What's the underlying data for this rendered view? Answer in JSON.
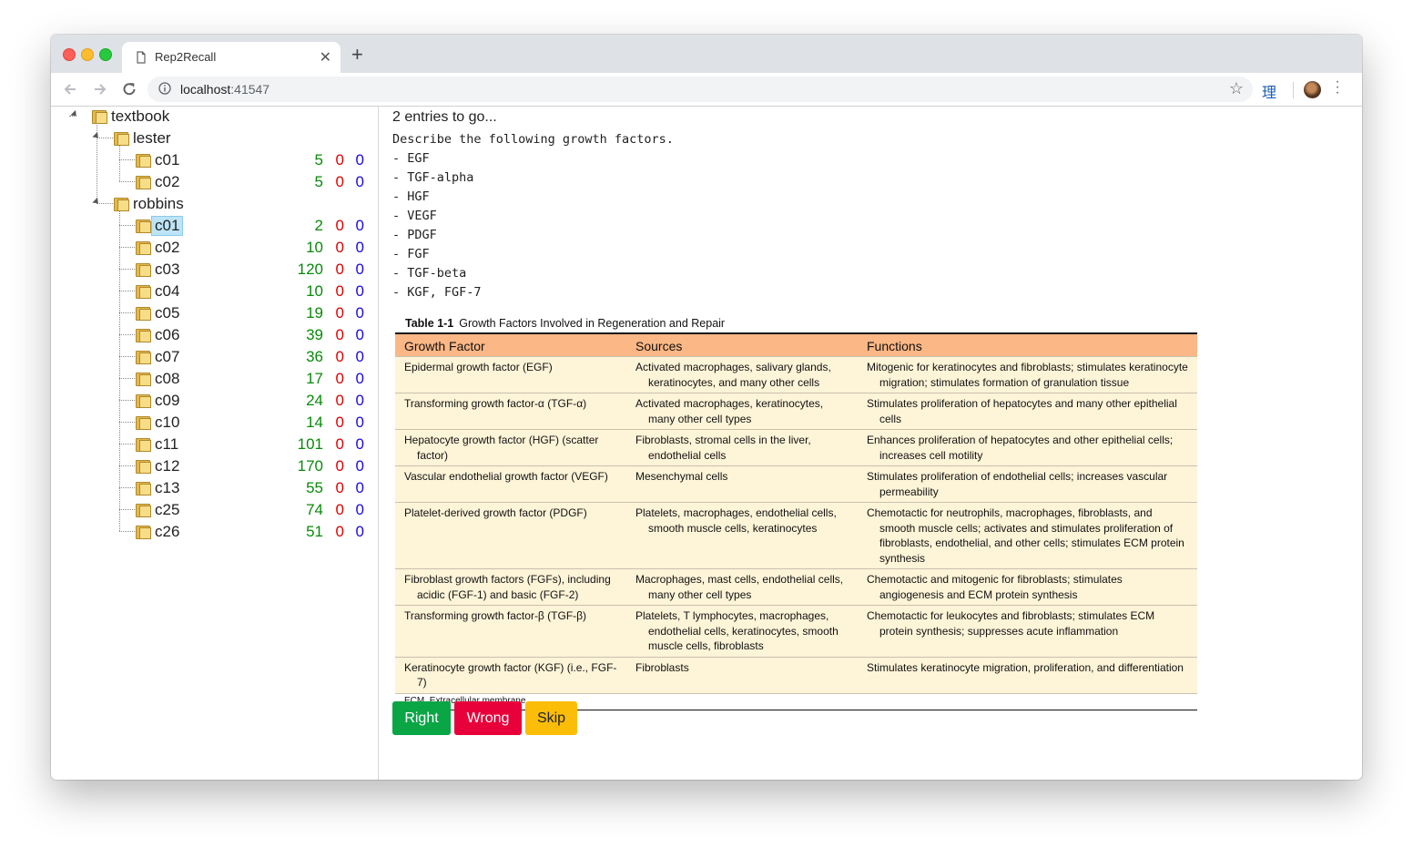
{
  "browser": {
    "tab_title": "Rep2Recall",
    "url_host": "localhost",
    "url_port": ":41547",
    "extension_label": "理"
  },
  "tree": {
    "root": "textbook",
    "groups": [
      {
        "name": "lester",
        "items": [
          {
            "label": "c01",
            "right": "5",
            "wrong": "0",
            "skip": "0"
          },
          {
            "label": "c02",
            "right": "5",
            "wrong": "0",
            "skip": "0"
          }
        ]
      },
      {
        "name": "robbins",
        "items": [
          {
            "label": "c01",
            "right": "2",
            "wrong": "0",
            "skip": "0",
            "selected": true
          },
          {
            "label": "c02",
            "right": "10",
            "wrong": "0",
            "skip": "0"
          },
          {
            "label": "c03",
            "right": "120",
            "wrong": "0",
            "skip": "0"
          },
          {
            "label": "c04",
            "right": "10",
            "wrong": "0",
            "skip": "0"
          },
          {
            "label": "c05",
            "right": "19",
            "wrong": "0",
            "skip": "0"
          },
          {
            "label": "c06",
            "right": "39",
            "wrong": "0",
            "skip": "0"
          },
          {
            "label": "c07",
            "right": "36",
            "wrong": "0",
            "skip": "0"
          },
          {
            "label": "c08",
            "right": "17",
            "wrong": "0",
            "skip": "0"
          },
          {
            "label": "c09",
            "right": "24",
            "wrong": "0",
            "skip": "0"
          },
          {
            "label": "c10",
            "right": "14",
            "wrong": "0",
            "skip": "0"
          },
          {
            "label": "c11",
            "right": "101",
            "wrong": "0",
            "skip": "0"
          },
          {
            "label": "c12",
            "right": "170",
            "wrong": "0",
            "skip": "0"
          },
          {
            "label": "c13",
            "right": "55",
            "wrong": "0",
            "skip": "0"
          },
          {
            "label": "c25",
            "right": "74",
            "wrong": "0",
            "skip": "0"
          },
          {
            "label": "c26",
            "right": "51",
            "wrong": "0",
            "skip": "0"
          }
        ]
      }
    ]
  },
  "card": {
    "status": "2 entries to go...",
    "question": "Describe the following growth factors.\n- EGF\n- TGF-alpha\n- HGF\n- VEGF\n- PDGF\n- FGF\n- TGF-beta\n- KGF, FGF-7",
    "table": {
      "caption_number": "Table 1-1",
      "caption_title": "Growth Factors Involved in Regeneration and Repair",
      "headers": [
        "Growth Factor",
        "Sources",
        "Functions"
      ],
      "rows": [
        [
          "Epidermal growth factor (EGF)",
          "Activated macrophages, salivary glands, keratinocytes, and many other cells",
          "Mitogenic for keratinocytes and fibroblasts; stimulates keratinocyte migration; stimulates formation of granulation tissue"
        ],
        [
          "Transforming growth factor-α (TGF-α)",
          "Activated macrophages, keratinocytes, many other cell types",
          "Stimulates proliferation of hepatocytes and many other epithelial cells"
        ],
        [
          "Hepatocyte growth factor (HGF) (scatter factor)",
          "Fibroblasts, stromal cells in the liver, endothelial cells",
          "Enhances proliferation of hepatocytes and other epithelial cells; increases cell motility"
        ],
        [
          "Vascular endothelial growth factor (VEGF)",
          "Mesenchymal cells",
          "Stimulates proliferation of endothelial cells; increases vascular permeability"
        ],
        [
          "Platelet-derived growth factor (PDGF)",
          "Platelets, macrophages, endothelial cells, smooth muscle cells, keratinocytes",
          "Chemotactic for neutrophils, macrophages, fibroblasts, and smooth muscle cells; activates and stimulates proliferation of fibroblasts, endothelial, and other cells; stimulates ECM protein synthesis"
        ],
        [
          "Fibroblast growth factors (FGFs), including acidic (FGF-1) and basic (FGF-2)",
          "Macrophages, mast cells, endothelial cells, many other cell types",
          "Chemotactic and mitogenic for fibroblasts; stimulates angiogenesis and ECM protein synthesis"
        ],
        [
          "Transforming growth factor-β (TGF-β)",
          "Platelets, T lymphocytes, macrophages, endothelial cells, keratinocytes, smooth muscle cells, fibroblasts",
          "Chemotactic for leukocytes and fibroblasts; stimulates ECM protein synthesis; suppresses acute inflammation"
        ],
        [
          "Keratinocyte growth factor (KGF) (i.e., FGF-7)",
          "Fibroblasts",
          "Stimulates keratinocyte migration, proliferation, and differentiation"
        ]
      ],
      "footnote": "ECM, Extracellular membrane."
    },
    "buttons": {
      "right": "Right",
      "wrong": "Wrong",
      "skip": "Skip"
    }
  },
  "colors": {
    "right": "#0aa646",
    "wrong": "#e8003a",
    "skip": "#fbbd08",
    "table_header": "#fbb785",
    "table_body": "#fef4d8",
    "count_green": "#0a8a0a",
    "count_red": "#e00000",
    "count_blue": "#1a0ae0"
  },
  "icons": {
    "tab": "page-icon",
    "back": "arrow-left-icon",
    "forward": "arrow-right-icon",
    "reload": "reload-icon",
    "info": "info-icon",
    "bookmark": "star-icon",
    "menu": "kebab-menu-icon",
    "tree_node": "folder-icon"
  }
}
